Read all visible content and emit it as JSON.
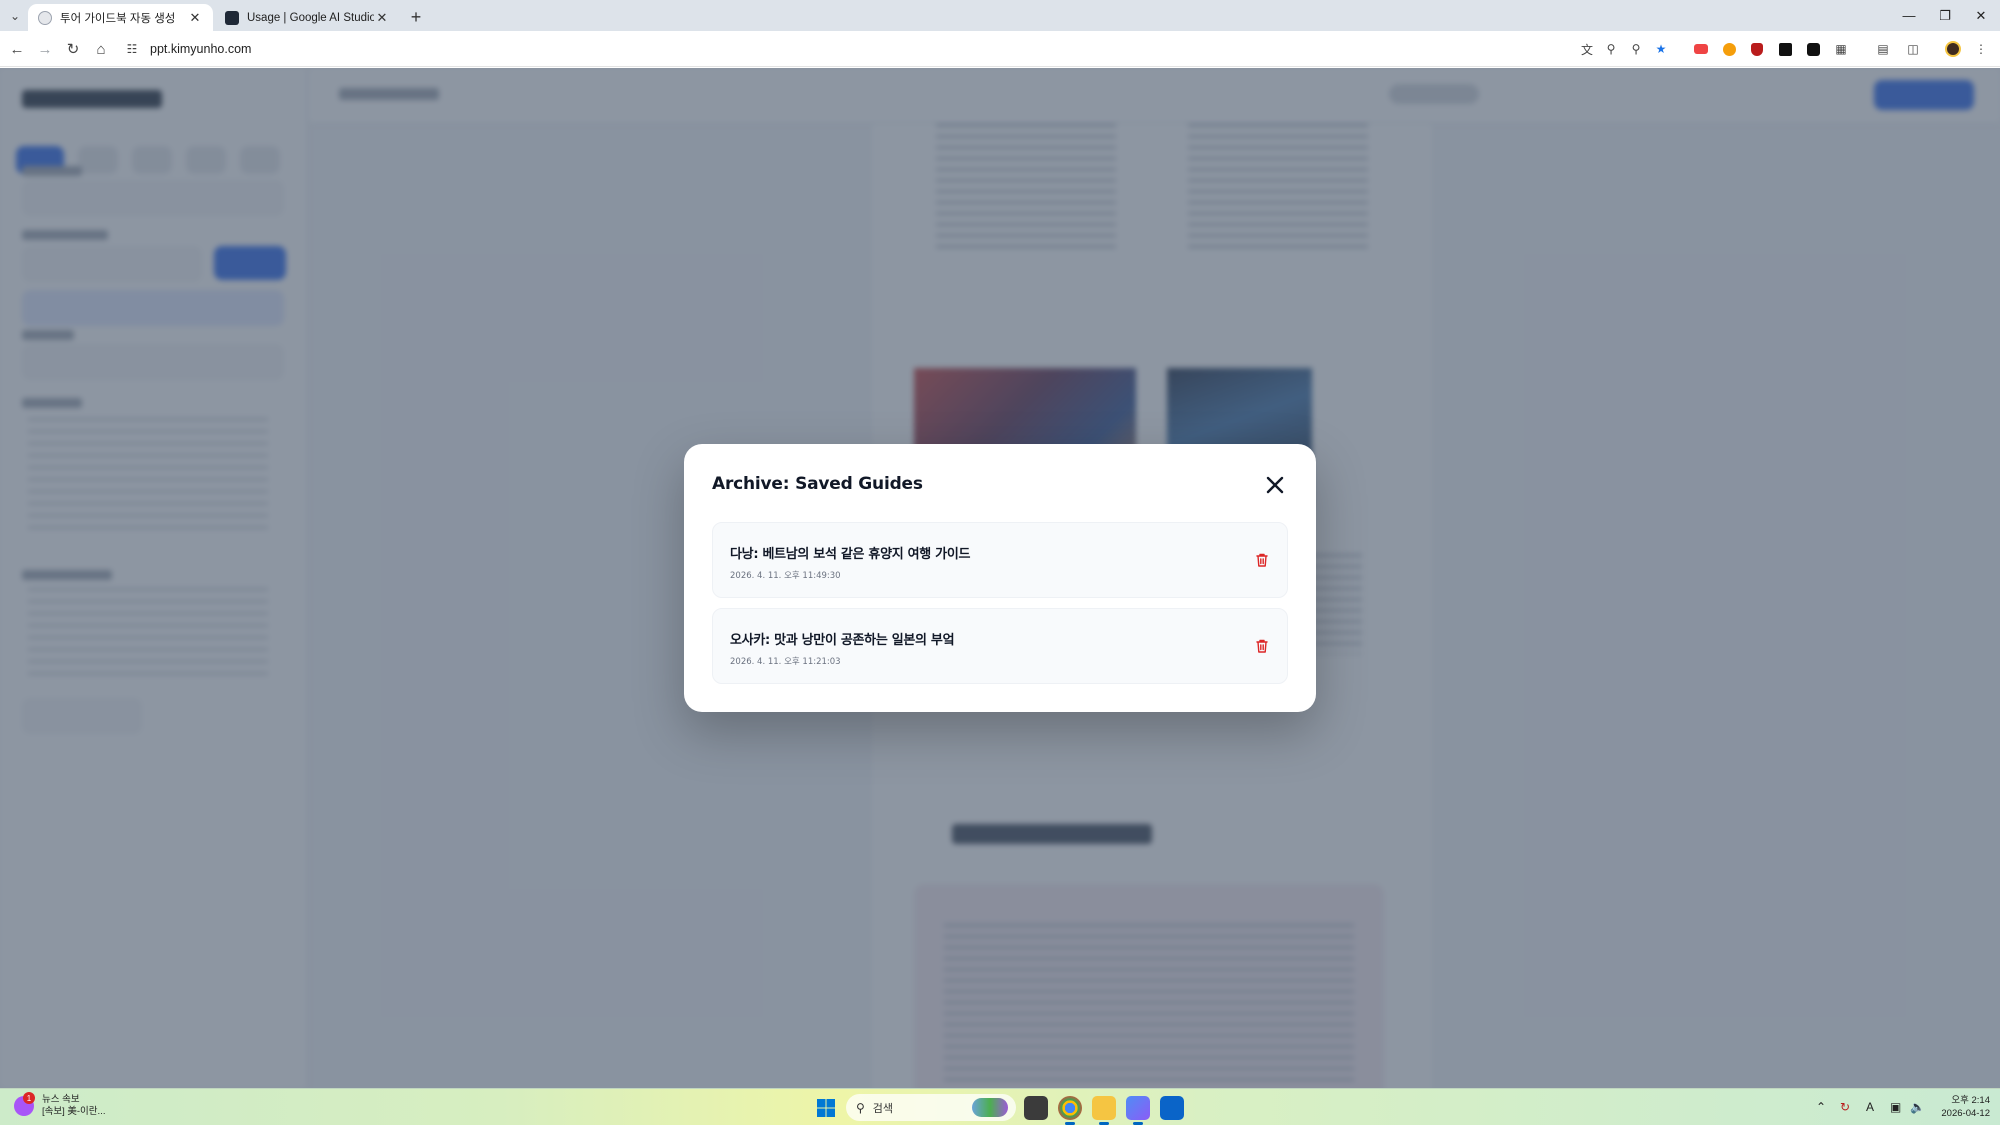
{
  "browser": {
    "tabs": [
      {
        "title": "투어 가이드북 자동 생성",
        "active": true
      },
      {
        "title": "Usage | Google AI Studio",
        "active": false
      }
    ],
    "url": "ppt.kimyunho.com"
  },
  "modal": {
    "title": "Archive: Saved Guides",
    "guides": [
      {
        "title": "다낭: 베트남의 보석 같은 휴양지 여행 가이드",
        "saved_at": "2026. 4. 11. 오후 11:49:30"
      },
      {
        "title": "오사카: 맛과 낭만이 공존하는 일본의 부엌",
        "saved_at": "2026. 4. 11. 오후 11:21:03"
      }
    ]
  },
  "taskbar": {
    "news_title": "뉴스 속보",
    "news_subtitle": "[속보] 美-이란...",
    "news_badge": "1",
    "search_placeholder": "검색",
    "time": "오후 2:14",
    "date": "2026-04-12"
  },
  "colors": {
    "accent": "#2563eb",
    "delete": "#dc2626",
    "overlay": "#475569"
  }
}
